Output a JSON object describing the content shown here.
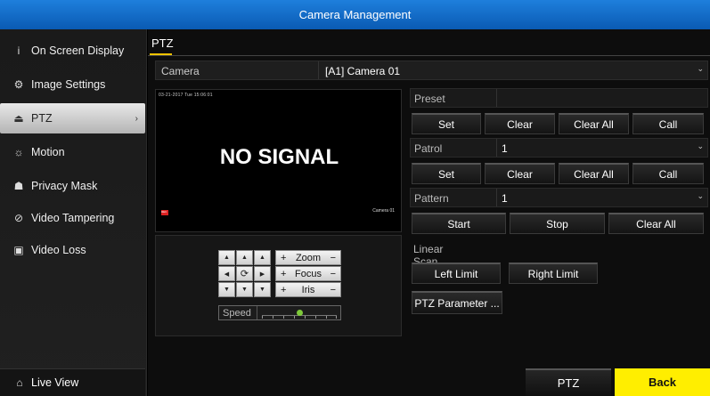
{
  "window": {
    "title": "Camera Management"
  },
  "sidebar": {
    "items": [
      {
        "label": "On Screen Display",
        "icon": "info-icon",
        "glyph": "i"
      },
      {
        "label": "Image Settings",
        "icon": "settings-gear-icon",
        "glyph": "⚙"
      },
      {
        "label": "PTZ",
        "icon": "ptz-dome-icon",
        "glyph": "⏏",
        "active": true,
        "arrow": "›"
      },
      {
        "label": "Motion",
        "icon": "motion-icon",
        "glyph": "☼"
      },
      {
        "label": "Privacy Mask",
        "icon": "privacy-mask-icon",
        "glyph": "☗"
      },
      {
        "label": "Video Tampering",
        "icon": "video-tampering-icon",
        "glyph": "⊘"
      },
      {
        "label": "Video Loss",
        "icon": "video-loss-icon",
        "glyph": "▣"
      }
    ],
    "live_view": {
      "label": "Live View",
      "glyph": "⌂"
    }
  },
  "main": {
    "tab": "PTZ",
    "camera": {
      "label": "Camera",
      "value": "[A1] Camera 01",
      "arrow": "⌄"
    },
    "video": {
      "osd_time": "03-21-2017 Tue 15:06:01",
      "no_signal": "NO SIGNAL",
      "rec_badge": "REC",
      "cam_osd": "Camera 01"
    },
    "ptz_control": {
      "arrows": {
        "up_left": "▲",
        "up": "▲",
        "up_right": "▲",
        "left": "◀",
        "auto": "⟳",
        "right": "▶",
        "down_left": "▼",
        "down": "▼",
        "down_right": "▼"
      },
      "zoom": {
        "plus": "+",
        "label": "Zoom",
        "minus": "−"
      },
      "focus": {
        "plus": "+",
        "label": "Focus",
        "minus": "−"
      },
      "iris": {
        "plus": "+",
        "label": "Iris",
        "minus": "−"
      },
      "speed": {
        "label": "Speed",
        "level": 0.5
      }
    },
    "preset": {
      "label": "Preset",
      "value": "",
      "buttons": [
        "Set",
        "Clear",
        "Clear All",
        "Call"
      ]
    },
    "patrol": {
      "label": "Patrol",
      "value": "1",
      "arrow": "⌄",
      "buttons": [
        "Set",
        "Clear",
        "Clear All",
        "Call"
      ]
    },
    "pattern": {
      "label": "Pattern",
      "value": "1",
      "arrow": "⌄",
      "buttons": [
        "Start",
        "Stop",
        "Clear All"
      ]
    },
    "linear_scan": {
      "label": "Linear Scan",
      "buttons": [
        "Left Limit",
        "Right Limit"
      ]
    },
    "ptz_parameter_button": "PTZ Parameter ..."
  },
  "footer": {
    "ptz_button": "PTZ",
    "back_button": "Back"
  },
  "colors": {
    "title_bar": "#0a5ab3",
    "tab_underline": "#f5c400",
    "back_button": "#ffee00",
    "speed_knob": "#7ec93a"
  }
}
